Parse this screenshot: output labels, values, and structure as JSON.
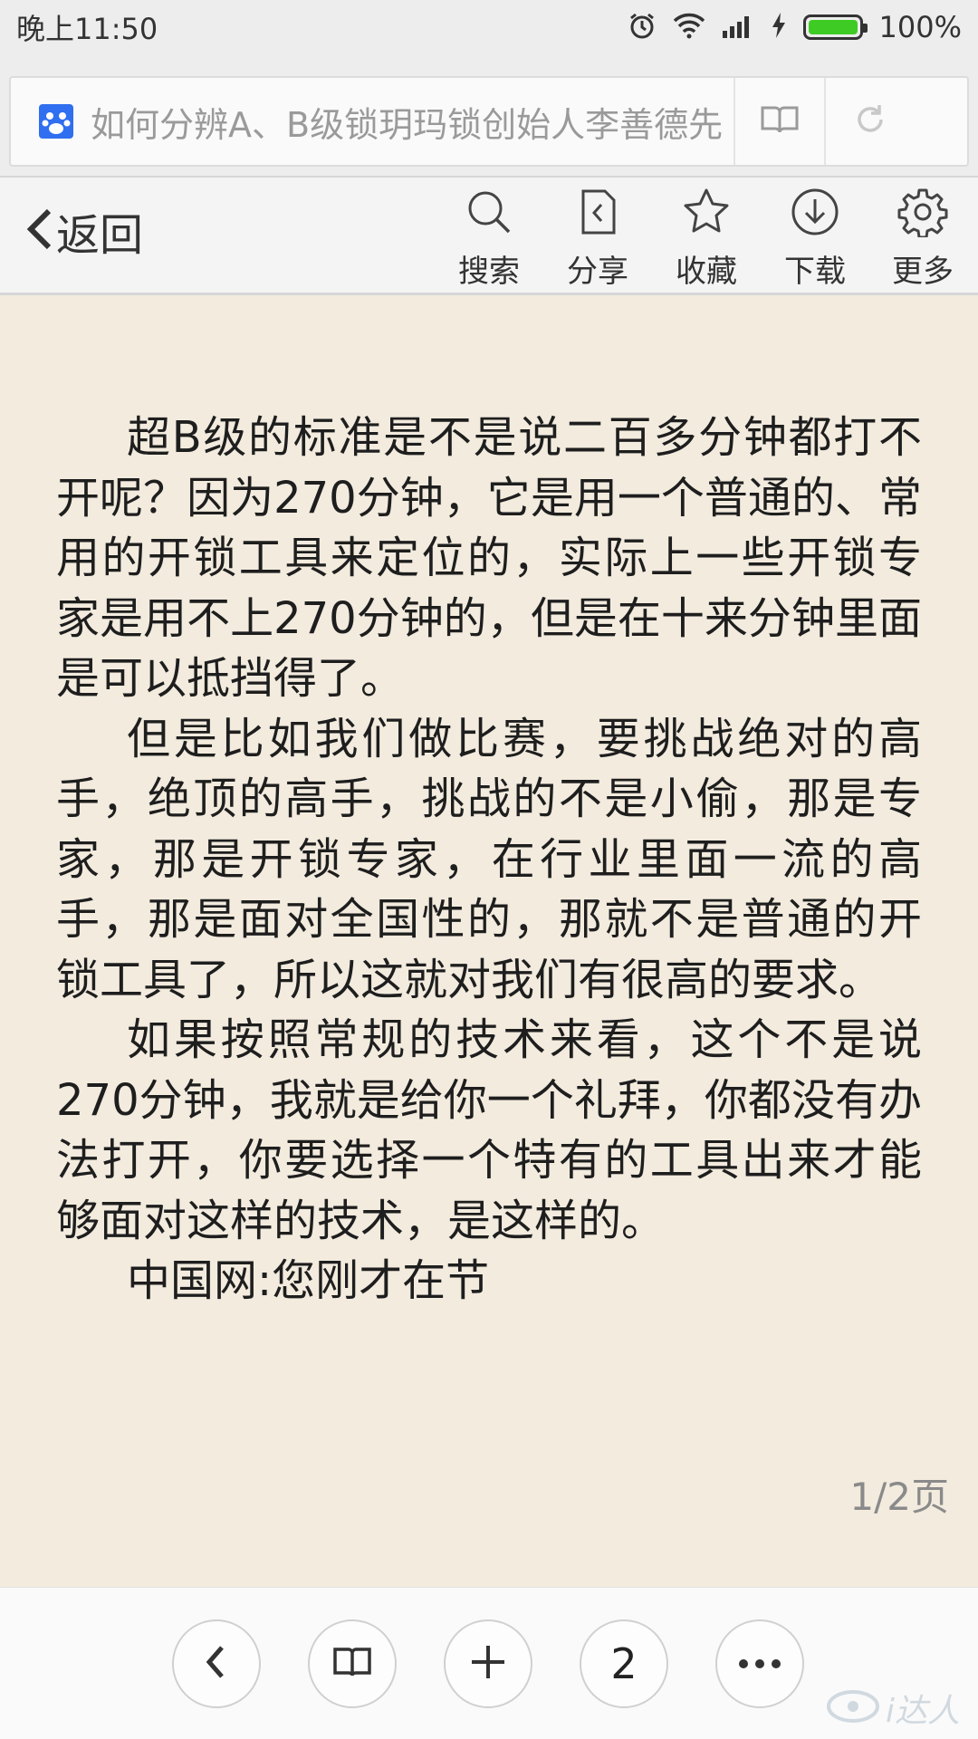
{
  "status_bar": {
    "time": "晚上11:50",
    "battery_percent": "100%",
    "battery_level": 1.0,
    "battery_color": "#3ecb23"
  },
  "url_bar": {
    "title": "如何分辨A、B级锁玥玛锁创始人李善德先",
    "favicon": "baidu-paw-icon"
  },
  "toolbar": {
    "back_label": "返回",
    "items": [
      {
        "label": "搜索",
        "icon": "search-icon"
      },
      {
        "label": "分享",
        "icon": "share-icon"
      },
      {
        "label": "收藏",
        "icon": "star-icon"
      },
      {
        "label": "下载",
        "icon": "download-icon"
      },
      {
        "label": "更多",
        "icon": "gear-icon"
      }
    ]
  },
  "article": {
    "paragraphs": [
      "超B级的标准是不是说二百多分钟都打不开呢？因为270分钟，它是用一个普通的、常用的开锁工具来定位的，实际上一些开锁专家是用不上270分钟的，但是在十来分钟里面是可以抵挡得了。",
      "但是比如我们做比赛，要挑战绝对的高手，绝顶的高手，挑战的不是小偷，那是专家，那是开锁专家，在行业里面一流的高手，那是面对全国性的，那就不是普通的开锁工具了，所以这就对我们有很高的要求。",
      "如果按照常规的技术来看，这个不是说270分钟，我就是给你一个礼拜，你都没有办法打开，你要选择一个特有的工具出来才能够面对这样的技术，是这样的。",
      "中国网:您刚才在节"
    ],
    "page_indicator": "1/2页"
  },
  "bottom_bar": {
    "tab_count": "2",
    "watermark": "i达人"
  },
  "colors": {
    "reading_background": "#f2ebde",
    "chrome_background": "#ededed"
  }
}
